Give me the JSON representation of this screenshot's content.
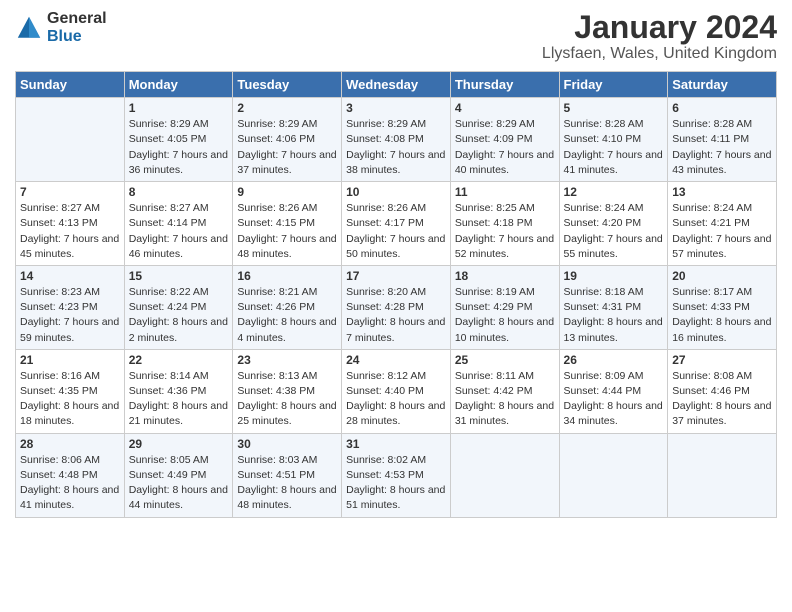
{
  "header": {
    "logo_general": "General",
    "logo_blue": "Blue",
    "title": "January 2024",
    "subtitle": "Llysfaen, Wales, United Kingdom"
  },
  "days_of_week": [
    "Sunday",
    "Monday",
    "Tuesday",
    "Wednesday",
    "Thursday",
    "Friday",
    "Saturday"
  ],
  "weeks": [
    [
      {
        "day": "",
        "sunrise": "",
        "sunset": "",
        "daylight": ""
      },
      {
        "day": "1",
        "sunrise": "Sunrise: 8:29 AM",
        "sunset": "Sunset: 4:05 PM",
        "daylight": "Daylight: 7 hours and 36 minutes."
      },
      {
        "day": "2",
        "sunrise": "Sunrise: 8:29 AM",
        "sunset": "Sunset: 4:06 PM",
        "daylight": "Daylight: 7 hours and 37 minutes."
      },
      {
        "day": "3",
        "sunrise": "Sunrise: 8:29 AM",
        "sunset": "Sunset: 4:08 PM",
        "daylight": "Daylight: 7 hours and 38 minutes."
      },
      {
        "day": "4",
        "sunrise": "Sunrise: 8:29 AM",
        "sunset": "Sunset: 4:09 PM",
        "daylight": "Daylight: 7 hours and 40 minutes."
      },
      {
        "day": "5",
        "sunrise": "Sunrise: 8:28 AM",
        "sunset": "Sunset: 4:10 PM",
        "daylight": "Daylight: 7 hours and 41 minutes."
      },
      {
        "day": "6",
        "sunrise": "Sunrise: 8:28 AM",
        "sunset": "Sunset: 4:11 PM",
        "daylight": "Daylight: 7 hours and 43 minutes."
      }
    ],
    [
      {
        "day": "7",
        "sunrise": "Sunrise: 8:27 AM",
        "sunset": "Sunset: 4:13 PM",
        "daylight": "Daylight: 7 hours and 45 minutes."
      },
      {
        "day": "8",
        "sunrise": "Sunrise: 8:27 AM",
        "sunset": "Sunset: 4:14 PM",
        "daylight": "Daylight: 7 hours and 46 minutes."
      },
      {
        "day": "9",
        "sunrise": "Sunrise: 8:26 AM",
        "sunset": "Sunset: 4:15 PM",
        "daylight": "Daylight: 7 hours and 48 minutes."
      },
      {
        "day": "10",
        "sunrise": "Sunrise: 8:26 AM",
        "sunset": "Sunset: 4:17 PM",
        "daylight": "Daylight: 7 hours and 50 minutes."
      },
      {
        "day": "11",
        "sunrise": "Sunrise: 8:25 AM",
        "sunset": "Sunset: 4:18 PM",
        "daylight": "Daylight: 7 hours and 52 minutes."
      },
      {
        "day": "12",
        "sunrise": "Sunrise: 8:24 AM",
        "sunset": "Sunset: 4:20 PM",
        "daylight": "Daylight: 7 hours and 55 minutes."
      },
      {
        "day": "13",
        "sunrise": "Sunrise: 8:24 AM",
        "sunset": "Sunset: 4:21 PM",
        "daylight": "Daylight: 7 hours and 57 minutes."
      }
    ],
    [
      {
        "day": "14",
        "sunrise": "Sunrise: 8:23 AM",
        "sunset": "Sunset: 4:23 PM",
        "daylight": "Daylight: 7 hours and 59 minutes."
      },
      {
        "day": "15",
        "sunrise": "Sunrise: 8:22 AM",
        "sunset": "Sunset: 4:24 PM",
        "daylight": "Daylight: 8 hours and 2 minutes."
      },
      {
        "day": "16",
        "sunrise": "Sunrise: 8:21 AM",
        "sunset": "Sunset: 4:26 PM",
        "daylight": "Daylight: 8 hours and 4 minutes."
      },
      {
        "day": "17",
        "sunrise": "Sunrise: 8:20 AM",
        "sunset": "Sunset: 4:28 PM",
        "daylight": "Daylight: 8 hours and 7 minutes."
      },
      {
        "day": "18",
        "sunrise": "Sunrise: 8:19 AM",
        "sunset": "Sunset: 4:29 PM",
        "daylight": "Daylight: 8 hours and 10 minutes."
      },
      {
        "day": "19",
        "sunrise": "Sunrise: 8:18 AM",
        "sunset": "Sunset: 4:31 PM",
        "daylight": "Daylight: 8 hours and 13 minutes."
      },
      {
        "day": "20",
        "sunrise": "Sunrise: 8:17 AM",
        "sunset": "Sunset: 4:33 PM",
        "daylight": "Daylight: 8 hours and 16 minutes."
      }
    ],
    [
      {
        "day": "21",
        "sunrise": "Sunrise: 8:16 AM",
        "sunset": "Sunset: 4:35 PM",
        "daylight": "Daylight: 8 hours and 18 minutes."
      },
      {
        "day": "22",
        "sunrise": "Sunrise: 8:14 AM",
        "sunset": "Sunset: 4:36 PM",
        "daylight": "Daylight: 8 hours and 21 minutes."
      },
      {
        "day": "23",
        "sunrise": "Sunrise: 8:13 AM",
        "sunset": "Sunset: 4:38 PM",
        "daylight": "Daylight: 8 hours and 25 minutes."
      },
      {
        "day": "24",
        "sunrise": "Sunrise: 8:12 AM",
        "sunset": "Sunset: 4:40 PM",
        "daylight": "Daylight: 8 hours and 28 minutes."
      },
      {
        "day": "25",
        "sunrise": "Sunrise: 8:11 AM",
        "sunset": "Sunset: 4:42 PM",
        "daylight": "Daylight: 8 hours and 31 minutes."
      },
      {
        "day": "26",
        "sunrise": "Sunrise: 8:09 AM",
        "sunset": "Sunset: 4:44 PM",
        "daylight": "Daylight: 8 hours and 34 minutes."
      },
      {
        "day": "27",
        "sunrise": "Sunrise: 8:08 AM",
        "sunset": "Sunset: 4:46 PM",
        "daylight": "Daylight: 8 hours and 37 minutes."
      }
    ],
    [
      {
        "day": "28",
        "sunrise": "Sunrise: 8:06 AM",
        "sunset": "Sunset: 4:48 PM",
        "daylight": "Daylight: 8 hours and 41 minutes."
      },
      {
        "day": "29",
        "sunrise": "Sunrise: 8:05 AM",
        "sunset": "Sunset: 4:49 PM",
        "daylight": "Daylight: 8 hours and 44 minutes."
      },
      {
        "day": "30",
        "sunrise": "Sunrise: 8:03 AM",
        "sunset": "Sunset: 4:51 PM",
        "daylight": "Daylight: 8 hours and 48 minutes."
      },
      {
        "day": "31",
        "sunrise": "Sunrise: 8:02 AM",
        "sunset": "Sunset: 4:53 PM",
        "daylight": "Daylight: 8 hours and 51 minutes."
      },
      {
        "day": "",
        "sunrise": "",
        "sunset": "",
        "daylight": ""
      },
      {
        "day": "",
        "sunrise": "",
        "sunset": "",
        "daylight": ""
      },
      {
        "day": "",
        "sunrise": "",
        "sunset": "",
        "daylight": ""
      }
    ]
  ]
}
